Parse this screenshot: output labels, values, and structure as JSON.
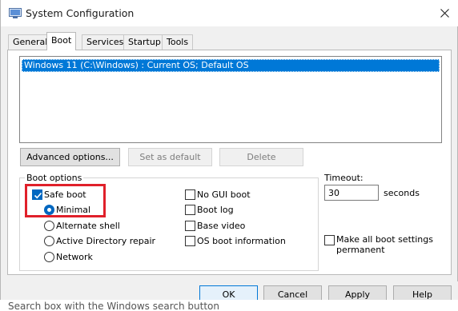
{
  "window": {
    "title": "System Configuration"
  },
  "tabs": [
    {
      "label": "General"
    },
    {
      "label": "Boot",
      "active": true
    },
    {
      "label": "Services"
    },
    {
      "label": "Startup"
    },
    {
      "label": "Tools"
    }
  ],
  "os_list": {
    "items": [
      "Windows 11 (C:\\Windows) : Current OS; Default OS"
    ],
    "selected": 0
  },
  "actions": {
    "advanced": "Advanced options...",
    "set_default": "Set as default",
    "delete": "Delete"
  },
  "boot_options": {
    "title": "Boot options",
    "safe_boot": {
      "label": "Safe boot",
      "checked": true
    },
    "minimal": {
      "label": "Minimal",
      "checked": true
    },
    "alternate_shell": {
      "label": "Alternate shell",
      "checked": false
    },
    "active_directory": {
      "label": "Active Directory repair",
      "checked": false
    },
    "network": {
      "label": "Network",
      "checked": false
    },
    "no_gui": {
      "label": "No GUI boot",
      "checked": false
    },
    "boot_log": {
      "label": "Boot log",
      "checked": false
    },
    "base_video": {
      "label": "Base video",
      "checked": false
    },
    "os_boot_info": {
      "label": "OS boot information",
      "checked": false
    }
  },
  "timeout": {
    "label": "Timeout:",
    "value": "30",
    "unit": "seconds"
  },
  "permanent": {
    "label_line1": "Make all boot settings",
    "label_line2": "permanent",
    "checked": false
  },
  "footer": {
    "ok": "OK",
    "cancel": "Cancel",
    "apply": "Apply",
    "help": "Help"
  },
  "background_text": "Search box with the Windows search button",
  "colors": {
    "selection": "#0078d7",
    "accent": "#0067c0",
    "highlight_box": "#e0202a"
  }
}
